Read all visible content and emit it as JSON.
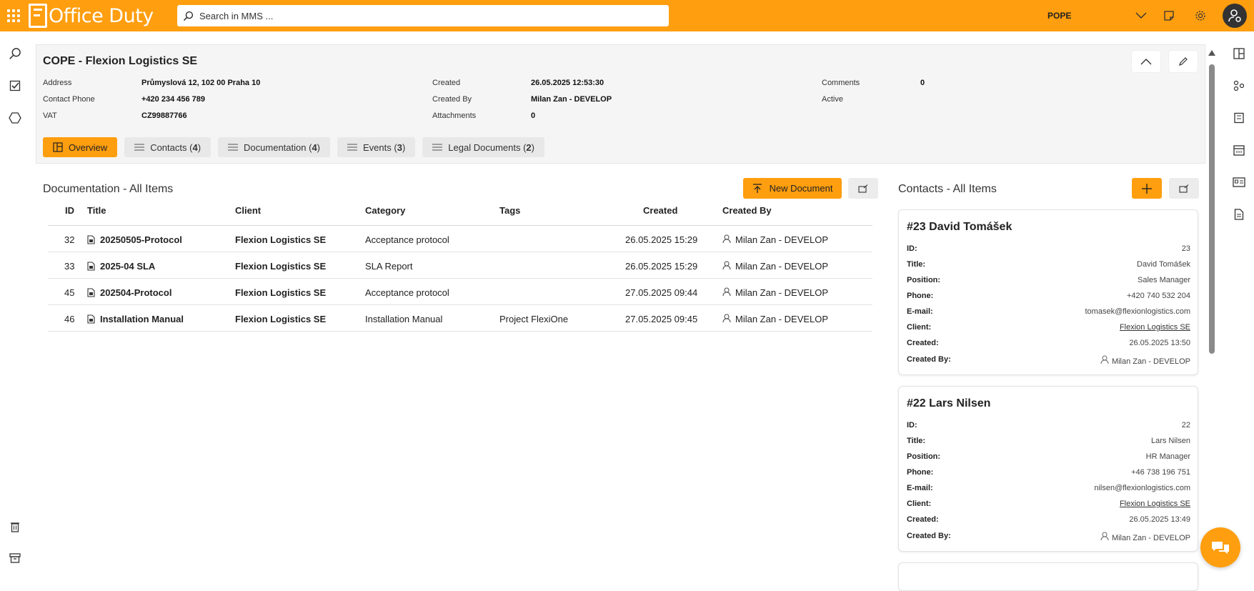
{
  "app": {
    "logo_text": "Office Duty",
    "brand_color": "#ff9e0f"
  },
  "search": {
    "placeholder": "Search in MMS ..."
  },
  "topbar": {
    "user": "POPE"
  },
  "header": {
    "title": "COPE - Flexion Logistics SE",
    "col1": [
      {
        "label": "Address",
        "value": "Průmyslová 12, 102 00 Praha 10"
      },
      {
        "label": "Contact Phone",
        "value": "+420 234 456 789"
      },
      {
        "label": "VAT",
        "value": "CZ99887766"
      }
    ],
    "col2": [
      {
        "label": "Created",
        "value": "26.05.2025 12:53:30"
      },
      {
        "label": "Created By",
        "value": "Milan Zan - DEVELOP"
      },
      {
        "label": "Attachments",
        "value": "0"
      }
    ],
    "col3": [
      {
        "label": "Comments",
        "value": "0"
      },
      {
        "label": "Active",
        "value": ""
      }
    ],
    "tabs": [
      {
        "label": "Overview",
        "count": ""
      },
      {
        "label": "Contacts",
        "count": "4"
      },
      {
        "label": "Documentation",
        "count": "4"
      },
      {
        "label": "Events",
        "count": "3"
      },
      {
        "label": "Legal Documents",
        "count": "2"
      }
    ]
  },
  "documentation": {
    "title": "Documentation - All Items",
    "new_button": "New Document",
    "columns": [
      "ID",
      "Title",
      "Client",
      "Category",
      "Tags",
      "Created",
      "Created By"
    ],
    "rows": [
      {
        "id": "32",
        "title": "20250505-Protocol",
        "client": "Flexion Logistics SE",
        "category": "Acceptance protocol",
        "tags": "",
        "created": "26.05.2025 15:29",
        "created_by": "Milan Zan - DEVELOP"
      },
      {
        "id": "33",
        "title": "2025-04 SLA",
        "client": "Flexion Logistics SE",
        "category": "SLA Report",
        "tags": "",
        "created": "26.05.2025 15:29",
        "created_by": "Milan Zan - DEVELOP"
      },
      {
        "id": "45",
        "title": "202504-Protocol",
        "client": "Flexion Logistics SE",
        "category": "Acceptance protocol",
        "tags": "",
        "created": "27.05.2025 09:44",
        "created_by": "Milan Zan - DEVELOP"
      },
      {
        "id": "46",
        "title": "Installation Manual",
        "client": "Flexion Logistics SE",
        "category": "Installation Manual",
        "tags": "Project FlexiOne",
        "created": "27.05.2025 09:45",
        "created_by": "Milan Zan - DEVELOP"
      }
    ]
  },
  "contacts": {
    "title": "Contacts - All Items",
    "labels": {
      "id": "ID:",
      "title": "Title:",
      "position": "Position:",
      "phone": "Phone:",
      "email": "E-mail:",
      "client": "Client:",
      "created": "Created:",
      "created_by": "Created By:"
    },
    "cards": [
      {
        "heading": "#23 David Tomášek",
        "id": "23",
        "title": "David Tomášek",
        "position": "Sales Manager",
        "phone": "+420 740 532 204",
        "email": "tomasek@flexionlogistics.com",
        "client": "Flexion Logistics SE",
        "created": "26.05.2025 13:50",
        "created_by": "Milan Zan - DEVELOP"
      },
      {
        "heading": "#22 Lars Nilsen",
        "id": "22",
        "title": "Lars Nilsen",
        "position": "HR Manager",
        "phone": "+46 738 196 751",
        "email": "nilsen@flexionlogistics.com",
        "client": "Flexion Logistics SE",
        "created": "26.05.2025 13:49",
        "created_by": "Milan Zan - DEVELOP"
      }
    ]
  }
}
